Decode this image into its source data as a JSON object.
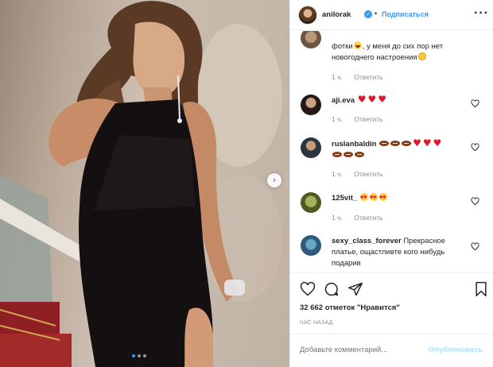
{
  "header": {
    "username": "anilorak",
    "separator": "•",
    "follow_label": "Подписаться",
    "more_icon": "more-horizontal-icon"
  },
  "carousel": {
    "next_icon": "chevron-right-icon",
    "next_glyph": "›",
    "dot_count": 3,
    "active_dot": 0
  },
  "comments": [
    {
      "username": "",
      "text_line1": "фотки",
      "text_line2": "у меня до сих пор нет",
      "text_line3": "новогоднего настроения",
      "emoji_after_line1": "grinning-face",
      "emoji_after_line3": "smiling-face",
      "time": "1 ч.",
      "reply_label": "Ответить"
    },
    {
      "username": "aji.eva",
      "emojis": [
        "red-heart",
        "red-heart",
        "red-heart"
      ],
      "time": "1 ч.",
      "reply_label": "Ответить"
    },
    {
      "username": "ruslanbaldin",
      "emojis_line1": [
        "american-football",
        "american-football",
        "american-football",
        "red-heart",
        "red-heart",
        "red-heart"
      ],
      "emojis_line2": [
        "american-football",
        "american-football",
        "american-football"
      ],
      "time": "1 ч.",
      "reply_label": "Ответить"
    },
    {
      "username": "125vit_",
      "emojis": [
        "heart-eyes-face",
        "heart-eyes-face",
        "heart-eyes-face"
      ],
      "time": "1 ч.",
      "reply_label": "Ответить"
    },
    {
      "username": "sexy_class_forever",
      "text_line1": "Прекрасное",
      "text_line2": "платье, ощастливте кого нибудь",
      "text_line3": "подарив",
      "time": "",
      "reply_label": ""
    }
  ],
  "actions": {
    "like_icon": "heart-icon",
    "comment_icon": "comment-icon",
    "share_icon": "share-icon",
    "save_icon": "bookmark-icon",
    "likes_text": "32 662 отметок \"Нравится\"",
    "timestamp": "ЧАС НАЗАД"
  },
  "add_comment": {
    "placeholder": "Добавьте комментарий...",
    "publish_label": "Опубликовать"
  },
  "colors": {
    "accent": "#3897f0",
    "text": "#262626",
    "muted": "#8e8e8e",
    "border": "#efefef",
    "heart_red": "#e0162b"
  }
}
